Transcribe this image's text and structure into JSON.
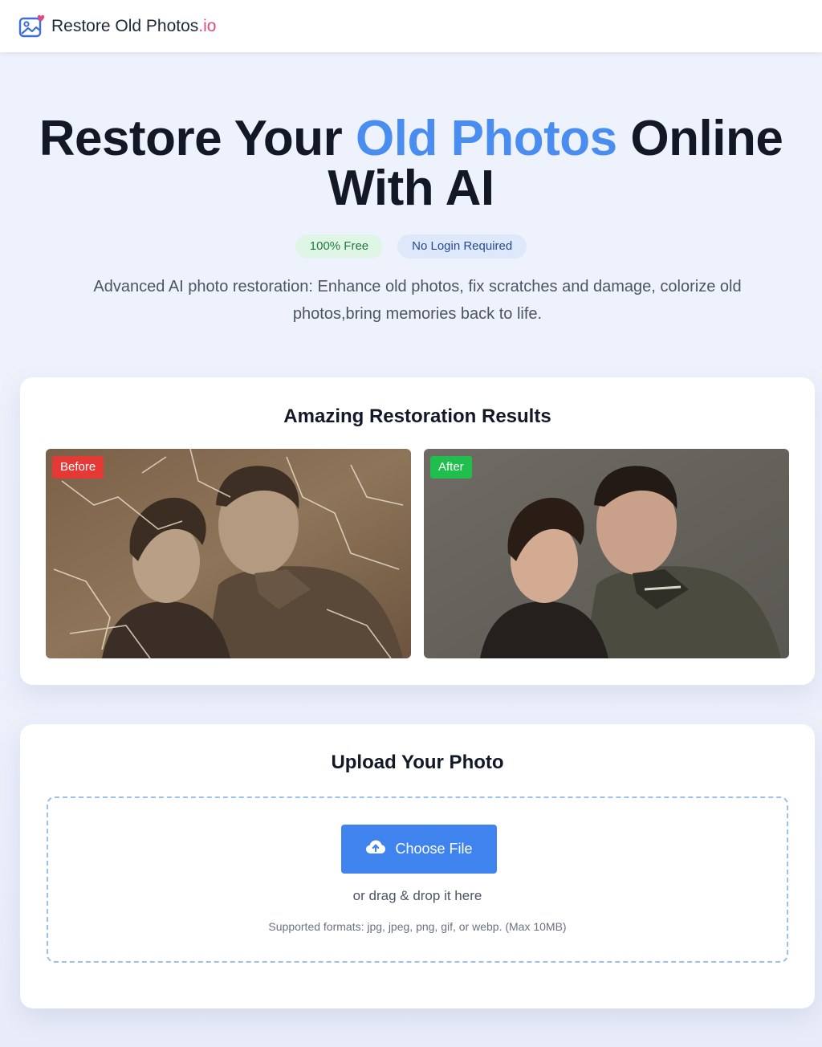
{
  "header": {
    "logo_icon": "photo-heart-icon",
    "brand_main": "Restore Old Photos",
    "brand_tld": ".io",
    "brand_color": "#e5487a"
  },
  "hero": {
    "title_part1": "Restore Your ",
    "title_accent": "Old Photos",
    "title_part2": " Online",
    "title_line2": "With AI",
    "accent_color": "#4a8df0",
    "badge_free": "100% Free",
    "badge_login": "No Login Required",
    "subtitle": "Advanced AI photo restoration: Enhance old photos, fix scratches and damage, colorize old photos,bring memories back to life."
  },
  "results": {
    "title": "Amazing Restoration Results",
    "before_label": "Before",
    "after_label": "After",
    "before_color": "#e53935",
    "after_color": "#1fbe4d"
  },
  "upload": {
    "title": "Upload Your Photo",
    "button_label": "Choose File",
    "button_icon": "cloud-upload-icon",
    "button_color": "#3f83ef",
    "drag_text": "or drag & drop it here",
    "formats_text": "Supported formats: jpg, jpeg, png, gif, or webp. (Max 10MB)"
  }
}
